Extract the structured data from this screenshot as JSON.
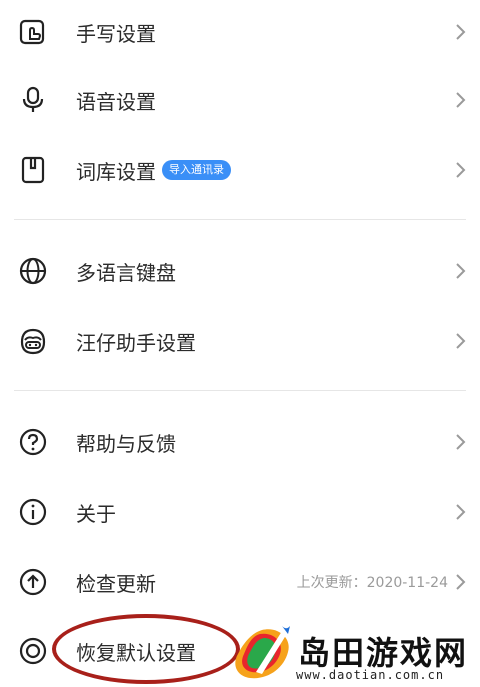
{
  "menu": {
    "handwriting": {
      "label": "手写设置",
      "icon": "handwriting-icon"
    },
    "voice": {
      "label": "语音设置",
      "icon": "microphone-icon"
    },
    "lexicon": {
      "label": "词库设置",
      "badge": "导入通讯录",
      "icon": "bookmark-icon"
    },
    "multilang": {
      "label": "多语言键盘",
      "icon": "globe-icon"
    },
    "assistant": {
      "label": "汪仔助手设置",
      "icon": "assistant-face-icon"
    },
    "help": {
      "label": "帮助与反馈",
      "icon": "question-icon"
    },
    "about": {
      "label": "关于",
      "icon": "info-icon"
    },
    "update": {
      "label": "检查更新",
      "meta": "上次更新：2020-11-24",
      "icon": "upload-arrow-icon"
    },
    "restore": {
      "label": "恢复默认设置",
      "icon": "restore-circle-icon"
    }
  },
  "watermark": {
    "title": "岛田游戏网",
    "url": "www.daotian.com.cn"
  },
  "colors": {
    "badge": "#3a8ff7",
    "highlight": "#a8201a",
    "divider": "#e6e6e6"
  }
}
